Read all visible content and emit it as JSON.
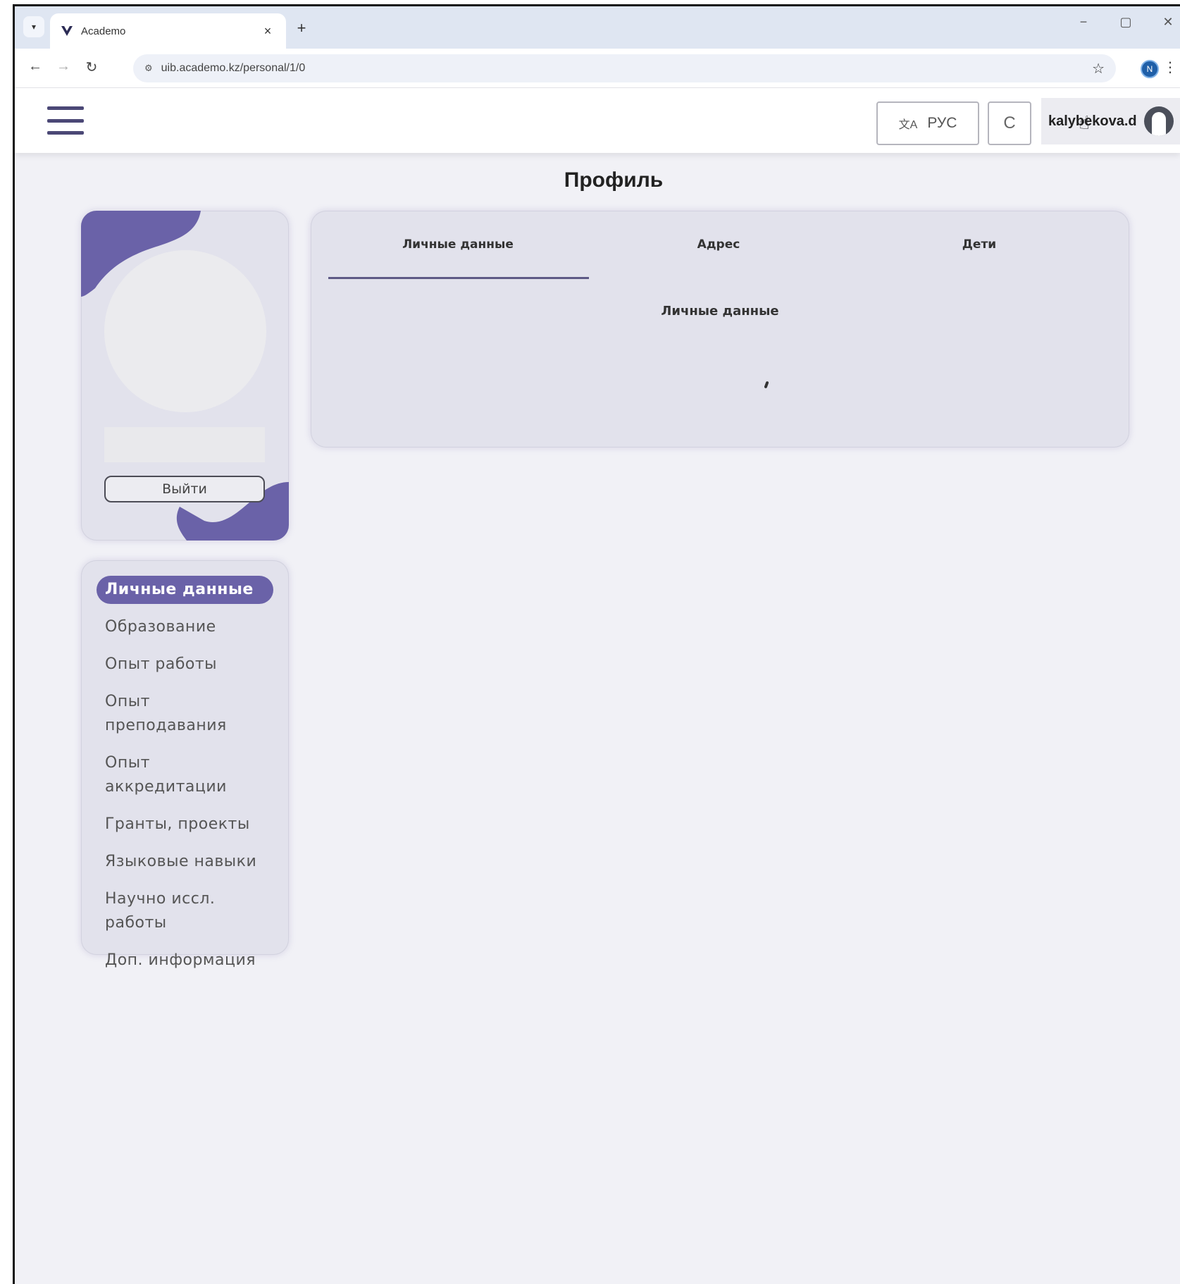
{
  "browser": {
    "tab_title": "Academo",
    "url": "uib.academo.kz/personal/1/0",
    "profile_initial": "N",
    "new_tab_label": "+",
    "close_tab_label": "×",
    "win_minimize": "−",
    "win_restore": "▢",
    "win_close": "✕"
  },
  "header": {
    "language_label": "РУС",
    "c_button_label": "C",
    "username": "kalybekova.d"
  },
  "page": {
    "title": "Профиль"
  },
  "profile_card": {
    "logout_label": "Выйти"
  },
  "sidebar": {
    "items": [
      {
        "label": "Личные данные",
        "active": true
      },
      {
        "label": "Образование"
      },
      {
        "label": "Опыт работы"
      },
      {
        "label": "Опыт преподавания"
      },
      {
        "label": "Опыт аккредитации"
      },
      {
        "label": "Гранты, проекты"
      },
      {
        "label": "Языковые навыки"
      },
      {
        "label": "Научно иссл. работы"
      },
      {
        "label": "Доп. информация"
      }
    ]
  },
  "content": {
    "tabs": [
      {
        "label": "Личные данные",
        "active": true
      },
      {
        "label": "Адрес"
      },
      {
        "label": "Дети"
      }
    ],
    "section_heading": "Личные данные"
  },
  "colors": {
    "accent": "#6a62a8",
    "card_bg": "#e2e2ec",
    "page_bg": "#f1f1f6"
  }
}
